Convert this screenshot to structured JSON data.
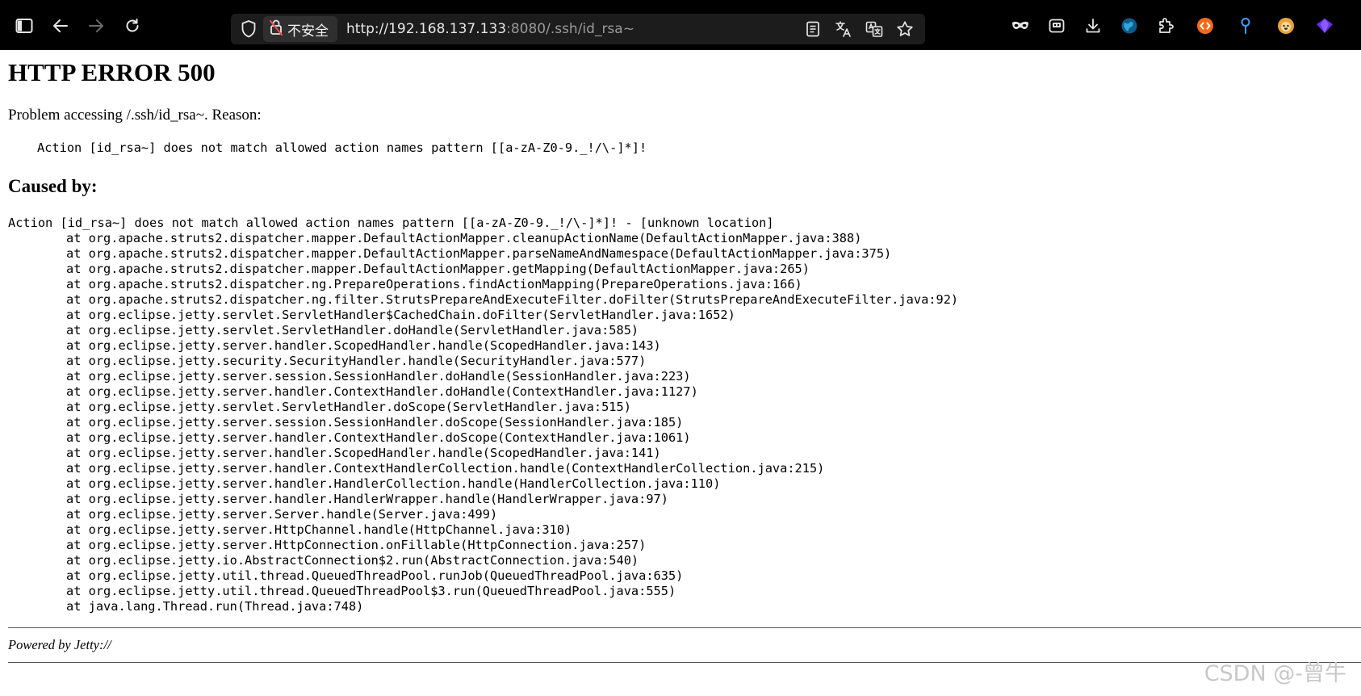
{
  "browser": {
    "insecure_label": "不安全",
    "url_host": "http://192.168.137.133",
    "url_rest": ":8080/.ssh/id_rsa~",
    "icons": {
      "sidebar": "sidebar-toggle-icon",
      "back": "back-arrow-icon",
      "forward": "forward-arrow-icon",
      "reload": "reload-icon",
      "shield": "tracking-shield-icon",
      "insecure": "insecure-lock-icon",
      "reader": "reader-view-icon",
      "translate": "translate-icon",
      "translate_alt": "page-translate-icon",
      "bookmark": "bookmark-star-icon",
      "private": "private-mask-icon",
      "extension_1": "extension-icon",
      "downloads": "download-icon",
      "extension_globe": "globe-extension-icon",
      "extensions": "puzzle-icon",
      "extension_orange": "orange-extension-icon",
      "extension_pin": "location-pin-icon",
      "extension_bear": "bear-extension-icon",
      "extension_purple": "purple-gem-icon"
    },
    "colors": {
      "toolbar_bg": "#000000",
      "urlbar_bg": "#1c1c1c",
      "url_host": "#e8e8e8",
      "url_rest": "#9a9a9a"
    }
  },
  "page": {
    "title": "HTTP ERROR 500",
    "problem": "Problem accessing /.ssh/id_rsa~. Reason:",
    "reason_message": "Action [id_rsa~] does not match allowed action names pattern [[a-zA-Z0-9._!/\\-]*]!",
    "caused_by_title": "Caused by:",
    "exception_line": "Action [id_rsa~] does not match allowed action names pattern [[a-zA-Z0-9._!/\\-]*]! - [unknown location]",
    "stack_frames": [
      "at org.apache.struts2.dispatcher.mapper.DefaultActionMapper.cleanupActionName(DefaultActionMapper.java:388)",
      "at org.apache.struts2.dispatcher.mapper.DefaultActionMapper.parseNameAndNamespace(DefaultActionMapper.java:375)",
      "at org.apache.struts2.dispatcher.mapper.DefaultActionMapper.getMapping(DefaultActionMapper.java:265)",
      "at org.apache.struts2.dispatcher.ng.PrepareOperations.findActionMapping(PrepareOperations.java:166)",
      "at org.apache.struts2.dispatcher.ng.filter.StrutsPrepareAndExecuteFilter.doFilter(StrutsPrepareAndExecuteFilter.java:92)",
      "at org.eclipse.jetty.servlet.ServletHandler$CachedChain.doFilter(ServletHandler.java:1652)",
      "at org.eclipse.jetty.servlet.ServletHandler.doHandle(ServletHandler.java:585)",
      "at org.eclipse.jetty.server.handler.ScopedHandler.handle(ScopedHandler.java:143)",
      "at org.eclipse.jetty.security.SecurityHandler.handle(SecurityHandler.java:577)",
      "at org.eclipse.jetty.server.session.SessionHandler.doHandle(SessionHandler.java:223)",
      "at org.eclipse.jetty.server.handler.ContextHandler.doHandle(ContextHandler.java:1127)",
      "at org.eclipse.jetty.servlet.ServletHandler.doScope(ServletHandler.java:515)",
      "at org.eclipse.jetty.server.session.SessionHandler.doScope(SessionHandler.java:185)",
      "at org.eclipse.jetty.server.handler.ContextHandler.doScope(ContextHandler.java:1061)",
      "at org.eclipse.jetty.server.handler.ScopedHandler.handle(ScopedHandler.java:141)",
      "at org.eclipse.jetty.server.handler.ContextHandlerCollection.handle(ContextHandlerCollection.java:215)",
      "at org.eclipse.jetty.server.handler.HandlerCollection.handle(HandlerCollection.java:110)",
      "at org.eclipse.jetty.server.handler.HandlerWrapper.handle(HandlerWrapper.java:97)",
      "at org.eclipse.jetty.server.Server.handle(Server.java:499)",
      "at org.eclipse.jetty.server.HttpChannel.handle(HttpChannel.java:310)",
      "at org.eclipse.jetty.server.HttpConnection.onFillable(HttpConnection.java:257)",
      "at org.eclipse.jetty.io.AbstractConnection$2.run(AbstractConnection.java:540)",
      "at org.eclipse.jetty.util.thread.QueuedThreadPool.runJob(QueuedThreadPool.java:635)",
      "at org.eclipse.jetty.util.thread.QueuedThreadPool$3.run(QueuedThreadPool.java:555)",
      "at java.lang.Thread.run(Thread.java:748)"
    ],
    "powered_by": "Powered by Jetty://",
    "watermark": "CSDN @-曾牛"
  }
}
